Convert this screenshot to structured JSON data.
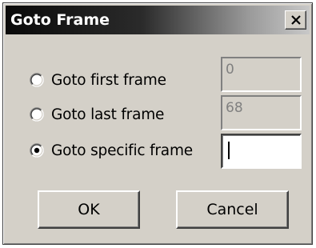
{
  "dialog": {
    "title": "Goto Frame",
    "close_symbol": "close-icon"
  },
  "options": [
    {
      "label": "Goto first frame",
      "selected": false,
      "field_value": "0",
      "field_enabled": false
    },
    {
      "label": "Goto last frame",
      "selected": false,
      "field_value": "68",
      "field_enabled": false
    },
    {
      "label": "Goto specific frame",
      "selected": true,
      "field_value": "",
      "field_enabled": true
    }
  ],
  "buttons": {
    "ok_label": "OK",
    "cancel_label": "Cancel"
  },
  "colors": {
    "face": "#d4d0c8",
    "disabled_text": "#808080"
  }
}
